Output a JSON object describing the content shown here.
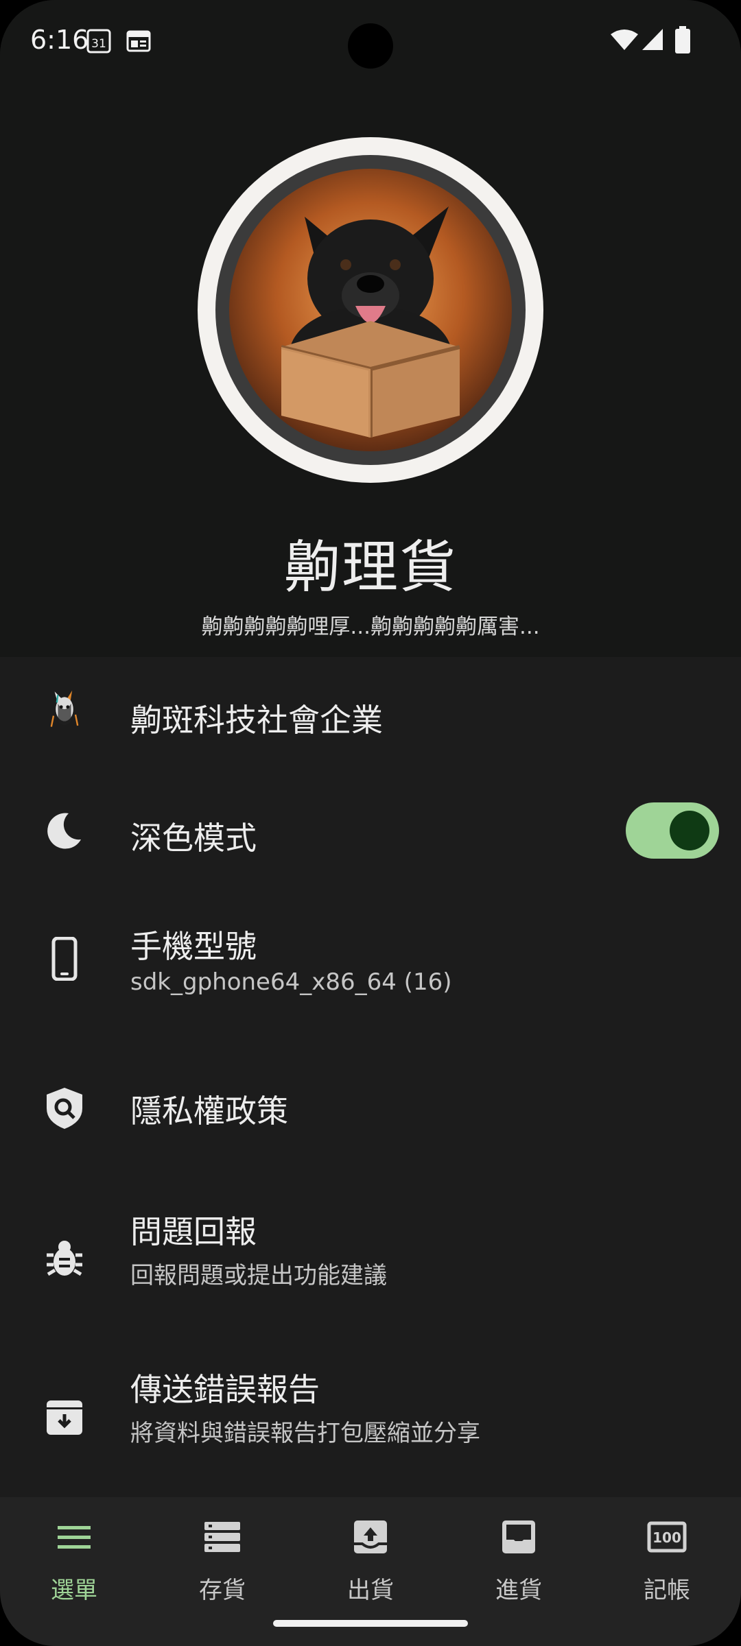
{
  "status": {
    "time": "6:16",
    "calendar_day": "31"
  },
  "header": {
    "title": "齁理貨",
    "subtitle": "齁齁齁齁齁哩厚...齁齁齁齁齁厲害..."
  },
  "menu": {
    "company": {
      "title": "齁斑科技社會企業"
    },
    "dark_mode": {
      "title": "深色模式",
      "enabled": true
    },
    "device": {
      "title": "手機型號",
      "subtitle": "sdk_gphone64_x86_64 (16)"
    },
    "privacy": {
      "title": "隱私權政策"
    },
    "feedback": {
      "title": "問題回報",
      "subtitle": "回報問題或提出功能建議"
    },
    "error_report": {
      "title": "傳送錯誤報告",
      "subtitle": "將資料與錯誤報告打包壓縮並分享"
    }
  },
  "nav": {
    "items": [
      {
        "label": "選單",
        "icon": "menu-icon",
        "active": true
      },
      {
        "label": "存貨",
        "icon": "storage-icon",
        "active": false
      },
      {
        "label": "出貨",
        "icon": "outbox-icon",
        "active": false
      },
      {
        "label": "進貨",
        "icon": "inbox-icon",
        "active": false
      },
      {
        "label": "記帳",
        "icon": "ledger-icon",
        "active": false
      }
    ]
  },
  "colors": {
    "accent": "#9fd497",
    "background": "#1c1c1c",
    "header": "#161716",
    "nav": "#232323"
  }
}
